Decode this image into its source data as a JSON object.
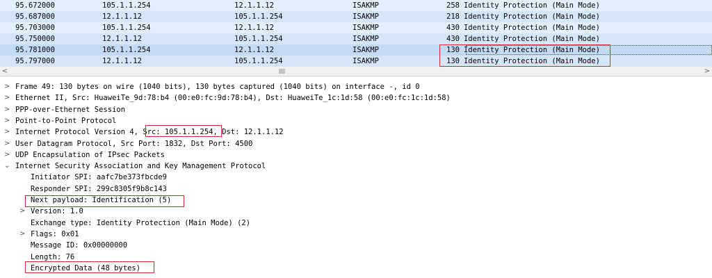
{
  "packets": [
    {
      "time": "95.672000",
      "src": "105.1.1.254",
      "dst": "12.1.1.12",
      "proto": "ISAKMP",
      "len": "258",
      "info": "Identity Protection (Main Mode)"
    },
    {
      "time": "95.687000",
      "src": "12.1.1.12",
      "dst": "105.1.1.254",
      "proto": "ISAKMP",
      "len": "218",
      "info": "Identity Protection (Main Mode)"
    },
    {
      "time": "95.703000",
      "src": "105.1.1.254",
      "dst": "12.1.1.12",
      "proto": "ISAKMP",
      "len": "430",
      "info": "Identity Protection (Main Mode)"
    },
    {
      "time": "95.750000",
      "src": "12.1.1.12",
      "dst": "105.1.1.254",
      "proto": "ISAKMP",
      "len": "430",
      "info": "Identity Protection (Main Mode)"
    },
    {
      "time": "95.781000",
      "src": "105.1.1.254",
      "dst": "12.1.1.12",
      "proto": "ISAKMP",
      "len": "130",
      "info": "Identity Protection (Main Mode)"
    },
    {
      "time": "95.797000",
      "src": "12.1.1.12",
      "dst": "105.1.1.254",
      "proto": "ISAKMP",
      "len": "130",
      "info": "Identity Protection (Main Mode)"
    }
  ],
  "selected_packet_index": 4,
  "scrollbar": {
    "left_arrow": "<",
    "right_arrow": ">"
  },
  "tree": [
    {
      "icon": "chevron-right-icon",
      "glyph": ">",
      "text": "Frame 49: 130 bytes on wire (1040 bits), 130 bytes captured (1040 bits) on interface -, id 0"
    },
    {
      "icon": "chevron-right-icon",
      "glyph": ">",
      "text": "Ethernet II, Src: HuaweiTe_9d:78:b4 (00:e0:fc:9d:78:b4), Dst: HuaweiTe_1c:1d:58 (00:e0:fc:1c:1d:58)"
    },
    {
      "icon": "chevron-right-icon",
      "glyph": ">",
      "text": "PPP-over-Ethernet Session"
    },
    {
      "icon": "chevron-right-icon",
      "glyph": ">",
      "text": "Point-to-Point Protocol"
    },
    {
      "icon": "chevron-right-icon",
      "glyph": ">",
      "text": "Internet Protocol Version 4, Src: 105.1.1.254, Dst: 12.1.1.12"
    },
    {
      "icon": "chevron-right-icon",
      "glyph": ">",
      "text": "User Datagram Protocol, Src Port: 1832, Dst Port: 4500"
    },
    {
      "icon": "chevron-right-icon",
      "glyph": ">",
      "text": "UDP Encapsulation of IPsec Packets"
    },
    {
      "icon": "chevron-down-icon",
      "glyph": "⌄",
      "text": "Internet Security Association and Key Management Protocol"
    },
    {
      "icon": "",
      "glyph": "",
      "text": "Initiator SPI: aafc7be373fbcde9"
    },
    {
      "icon": "",
      "glyph": "",
      "text": "Responder SPI: 299c8305f9b8c143"
    },
    {
      "icon": "",
      "glyph": "",
      "text": "Next payload: Identification (5)"
    },
    {
      "icon": "chevron-right-icon",
      "glyph": ">",
      "text": "Version: 1.0"
    },
    {
      "icon": "",
      "glyph": "",
      "text": "Exchange type: Identity Protection (Main Mode) (2)"
    },
    {
      "icon": "chevron-right-icon",
      "glyph": ">",
      "text": "Flags: 0x01"
    },
    {
      "icon": "",
      "glyph": "",
      "text": "Message ID: 0x00000000"
    },
    {
      "icon": "",
      "glyph": "",
      "text": "Length: 76"
    },
    {
      "icon": "",
      "glyph": "",
      "text": "Encrypted Data (48 bytes)"
    }
  ],
  "highlight_color": "#d9262b",
  "selected_row_color": "#c4dbf6"
}
